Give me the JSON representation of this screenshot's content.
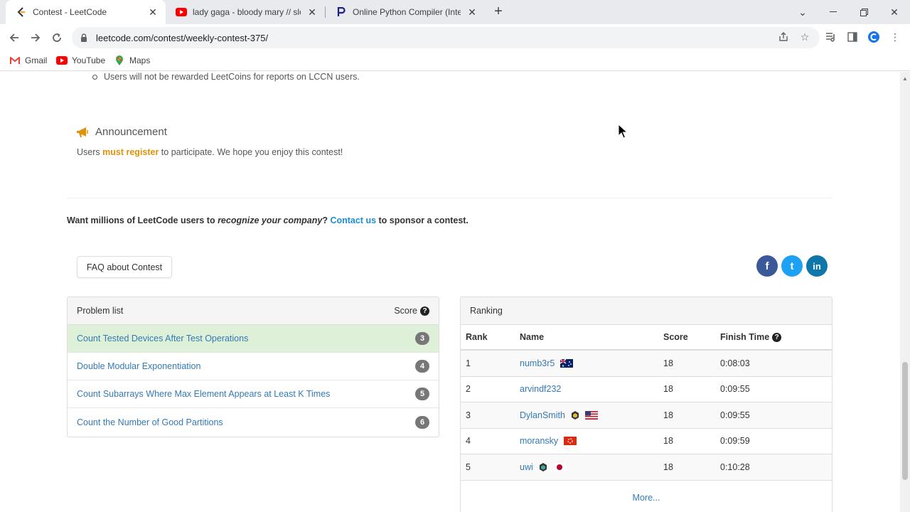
{
  "browser": {
    "tabs": [
      {
        "title": "Contest - LeetCode",
        "active": true,
        "favicon": "leetcode-icon"
      },
      {
        "title": "lady gaga - bloody mary // slowe",
        "active": false,
        "favicon": "youtube-icon"
      },
      {
        "title": "Online Python Compiler (Interpre",
        "active": false,
        "favicon": "programiz-icon"
      }
    ],
    "new_tab": "+",
    "url": "leetcode.com/contest/weekly-contest-375/",
    "bookmarks": [
      {
        "label": "Gmail",
        "icon": "gmail-icon"
      },
      {
        "label": "YouTube",
        "icon": "youtube-icon"
      },
      {
        "label": "Maps",
        "icon": "maps-icon"
      }
    ]
  },
  "rules": {
    "last_item": "Users will not be rewarded LeetCoins for reports on LCCN users."
  },
  "announcement": {
    "title": "Announcement",
    "text_pre": "Users ",
    "text_highlight": "must register",
    "text_post": " to participate. We hope you enjoy this contest!"
  },
  "sponsor": {
    "pre": "Want millions of LeetCode users to ",
    "emph": "recognize your company",
    "mid": "? ",
    "link": "Contact us",
    "post": " to sponsor a contest."
  },
  "faq_button": "FAQ about Contest",
  "social": {
    "facebook": {
      "label": "f",
      "color": "#3b5998"
    },
    "twitter": {
      "label": "t",
      "color": "#1da1f2"
    },
    "linkedin": {
      "label": "in",
      "color": "#0e76a8"
    }
  },
  "problems": {
    "header": "Problem list",
    "score_label": "Score",
    "help_mark": "?",
    "items": [
      {
        "name": "Count Tested Devices After Test Operations",
        "score": "3"
      },
      {
        "name": "Double Modular Exponentiation",
        "score": "4"
      },
      {
        "name": "Count Subarrays Where Max Element Appears at Least K Times",
        "score": "5"
      },
      {
        "name": "Count the Number of Good Partitions",
        "score": "6"
      }
    ]
  },
  "ranking": {
    "header": "Ranking",
    "columns": {
      "rank": "Rank",
      "name": "Name",
      "score": "Score",
      "finish": "Finish Time"
    },
    "help_mark": "?",
    "rows": [
      {
        "rank": "1",
        "name": "numb3r5",
        "score": "18",
        "time": "0:08:03",
        "flag": "australia-flag-icon"
      },
      {
        "rank": "2",
        "name": "arvindf232",
        "score": "18",
        "time": "0:09:55"
      },
      {
        "rank": "3",
        "name": "DylanSmith",
        "score": "18",
        "time": "0:09:55",
        "badge": "medal-icon",
        "flag": "usa-flag-icon"
      },
      {
        "rank": "4",
        "name": "moransky",
        "score": "18",
        "time": "0:09:59",
        "flag": "hongkong-flag-icon"
      },
      {
        "rank": "5",
        "name": "uwi",
        "score": "18",
        "time": "0:10:28",
        "badge": "medal-icon",
        "flag": "japan-flag-icon"
      }
    ],
    "more": "More..."
  },
  "colors": {
    "accent_orange": "#e0920a",
    "link_blue": "#337ab7",
    "solved_green": "#dff0d8"
  }
}
